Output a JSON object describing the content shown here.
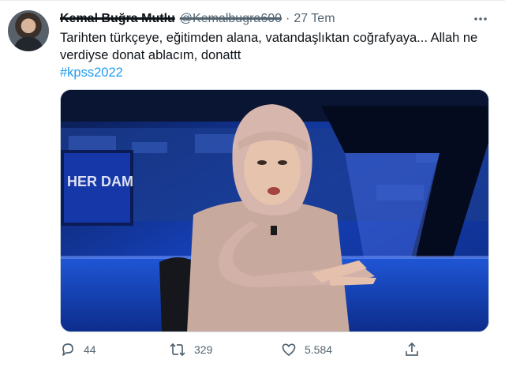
{
  "tweet": {
    "name": "Kemal Buğra Mutlu",
    "handle": "@Kemalbugra600",
    "separator": "·",
    "time": "27 Tem",
    "text": "Tarihten türkçeye, eğitimden alana, vatandaşlıktan coğrafyaya... Allah ne verdiyse donat ablacım, donattt",
    "hashtag": "#kpss2022",
    "media": {
      "backdrop_label": "HER DAM"
    },
    "actions": {
      "reply_count": "44",
      "retweet_count": "329",
      "like_count": "5.584"
    }
  },
  "colors": {
    "link": "#1d9bf0",
    "muted": "#536471"
  },
  "icons": [
    "reply-icon",
    "retweet-icon",
    "like-icon",
    "share-icon",
    "more-icon"
  ]
}
